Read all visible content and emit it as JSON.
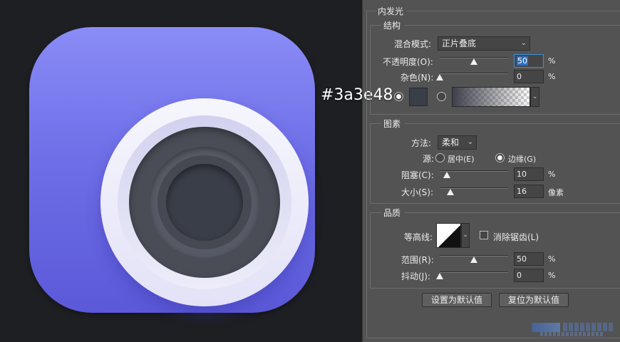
{
  "preview": {
    "color_label": "#3a3e48",
    "icon_colors": {
      "tile_top": "#8a8cf6",
      "tile_bottom": "#5b59d8",
      "core": "#3a3e48"
    }
  },
  "panel": {
    "title": "内发光",
    "structure": {
      "title": "结构",
      "blend_mode_label": "混合模式:",
      "blend_mode_value": "正片叠底",
      "opacity_label": "不透明度(O):",
      "opacity_value": "50",
      "opacity_unit": "%",
      "noise_label": "杂色(N):",
      "noise_value": "0",
      "noise_unit": "%",
      "swatch_color": "#3a3e48"
    },
    "elements": {
      "title": "图素",
      "technique_label": "方法:",
      "technique_value": "柔和",
      "source_label": "源:",
      "source_center": "居中(E)",
      "source_edge": "边缘(G)",
      "choke_label": "阻塞(C):",
      "choke_value": "10",
      "choke_unit": "%",
      "size_label": "大小(S):",
      "size_value": "16",
      "size_unit": "像素"
    },
    "quality": {
      "title": "品质",
      "contour_label": "等高线:",
      "antialias_label": "消除锯齿(L)",
      "range_label": "范围(R):",
      "range_value": "50",
      "range_unit": "%",
      "jitter_label": "抖动(J):",
      "jitter_value": "0",
      "jitter_unit": "%"
    },
    "buttons": {
      "make_default": "设置为默认值",
      "reset_default": "复位为默认值"
    },
    "slider_levels": {
      "opacity": 0.5,
      "noise": 0,
      "choke": 0.1,
      "size": 0.16,
      "range": 0.5,
      "jitter": 0
    }
  }
}
